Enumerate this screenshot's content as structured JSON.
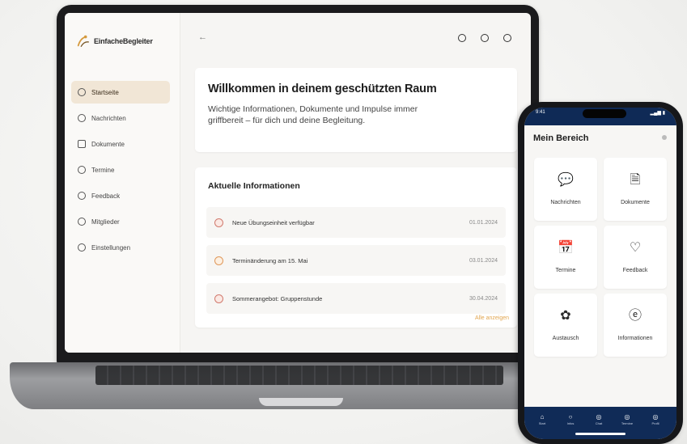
{
  "laptop": {
    "brand": "EinfacheBegleiter",
    "back_arrow": "←",
    "top_icons": [
      "search-icon",
      "info-icon",
      "profile-icon"
    ],
    "nav": [
      {
        "label": "Startseite",
        "icon": "home-icon",
        "active": true
      },
      {
        "label": "Nachrichten",
        "icon": "message-icon"
      },
      {
        "label": "Dokumente",
        "icon": "document-icon"
      },
      {
        "label": "Termine",
        "icon": "calendar-icon"
      },
      {
        "label": "Feedback",
        "icon": "feedback-icon"
      },
      {
        "label": "Mitglieder",
        "icon": "members-icon"
      },
      {
        "label": "Einstellungen",
        "icon": "settings-icon"
      }
    ],
    "welcome": {
      "title": "Willkommen in deinem geschützten Raum",
      "text": "Wichtige Informationen, Dokumente und Impulse immer griffbereit – für dich und deine Begleitung."
    },
    "info": {
      "title": "Aktuelle Informationen",
      "rows": [
        {
          "text": "Neue Übungseinheit verfügbar",
          "date": "01.01.2024"
        },
        {
          "text": "Terminänderung am 15. Mai",
          "date": "03.01.2024"
        },
        {
          "text": "Sommerangebot: Gruppenstunde",
          "date": "30.04.2024"
        }
      ],
      "all_link": "Alle anzeigen"
    }
  },
  "phone": {
    "status_time": "9:41",
    "status_right": "▂▄▆ ▮",
    "title": "Mein Bereich",
    "tiles": [
      {
        "label": "Nachrichten",
        "icon": "message-icon",
        "glyph": "💬"
      },
      {
        "label": "Dokumente",
        "icon": "document-icon",
        "glyph": "🗎"
      },
      {
        "label": "Termine",
        "icon": "calendar-icon",
        "glyph": "📅"
      },
      {
        "label": "Feedback",
        "icon": "heart-icon",
        "glyph": "♡"
      },
      {
        "label": "Austausch",
        "icon": "flower-icon",
        "glyph": "✿"
      },
      {
        "label": "Informationen",
        "icon": "info-icon",
        "glyph": "ⓔ"
      }
    ],
    "tabs": [
      {
        "label": "Start",
        "glyph": "⌂"
      },
      {
        "label": "Infos",
        "glyph": "○"
      },
      {
        "label": "Chat",
        "glyph": "◎"
      },
      {
        "label": "Termine",
        "glyph": "◎"
      },
      {
        "label": "Profil",
        "glyph": "◎"
      }
    ]
  },
  "colors": {
    "accent": "#f1e6d6",
    "navy": "#102b57",
    "link": "#e2a650"
  }
}
